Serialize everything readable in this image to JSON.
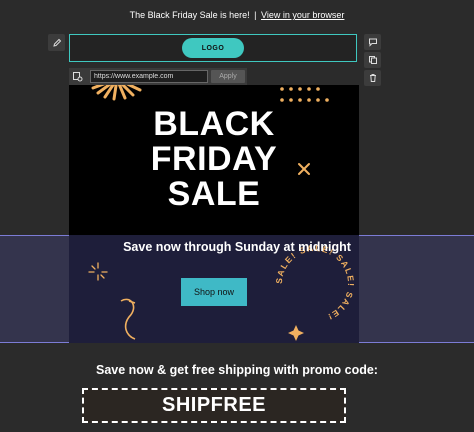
{
  "preheader": {
    "text": "The Black Friday Sale is here!",
    "separator": "|",
    "link_label": "View in your browser"
  },
  "logo": {
    "label": "LOGO"
  },
  "link_editor": {
    "url_value": "https://www.example.com",
    "apply_label": "Apply"
  },
  "hero": {
    "line1": "BLACK",
    "line2": "FRIDAY",
    "line3": "SALE"
  },
  "badge": {
    "text": "SALE! SALE! SALE! SALE! "
  },
  "band": {
    "subtitle": "Save now through Sunday at midnight",
    "button_label": "Shop now"
  },
  "promo": {
    "text": "Save now & get free shipping with promo code:",
    "code": "SHIPFREE"
  },
  "colors": {
    "accent_teal": "#3fc8c0",
    "decor_orange": "#f0b060",
    "band_highlight": "#7c7cd6"
  },
  "icons": {
    "edit": "pencil-icon",
    "comment": "comment-icon",
    "duplicate": "duplicate-icon",
    "delete": "trash-icon",
    "link_settings": "link-settings-icon"
  }
}
